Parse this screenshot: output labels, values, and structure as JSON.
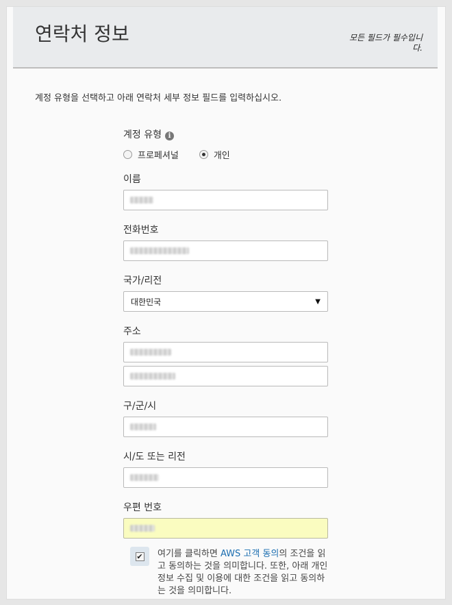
{
  "header": {
    "title": "연락처 정보",
    "required_note": "모든 필드가 필수입니다."
  },
  "intro": "계정 유형을 선택하고 아래 연락처 세부 정보 필드를 입력하십시오.",
  "account_type": {
    "label": "계정 유형",
    "options": [
      {
        "label": "프로페셔널",
        "checked": false
      },
      {
        "label": "개인",
        "checked": true
      }
    ]
  },
  "fields": {
    "name": {
      "label": "이름"
    },
    "phone": {
      "label": "전화번호"
    },
    "country": {
      "label": "국가/리전",
      "value": "대한민국"
    },
    "address": {
      "label": "주소"
    },
    "city": {
      "label": "구/군/시"
    },
    "state": {
      "label": "시/도 또는 리전"
    },
    "postal": {
      "label": "우편 번호"
    }
  },
  "agreement": {
    "checked": true,
    "line1_prefix": "여기를 클릭하면 ",
    "link_text": "AWS 고객 동의",
    "line1_suffix": "의 조건",
    "rest": "을 읽고 동의하는 것을 의미합니다. 또한, 아래 개인정보 수집 및 이용에 대한 조건을 읽고 동의하는 것을 의미합니다."
  },
  "colors": {
    "link": "#1a6db0",
    "highlight_field": "#fafcc0",
    "header_bg": "#e9ebed"
  }
}
